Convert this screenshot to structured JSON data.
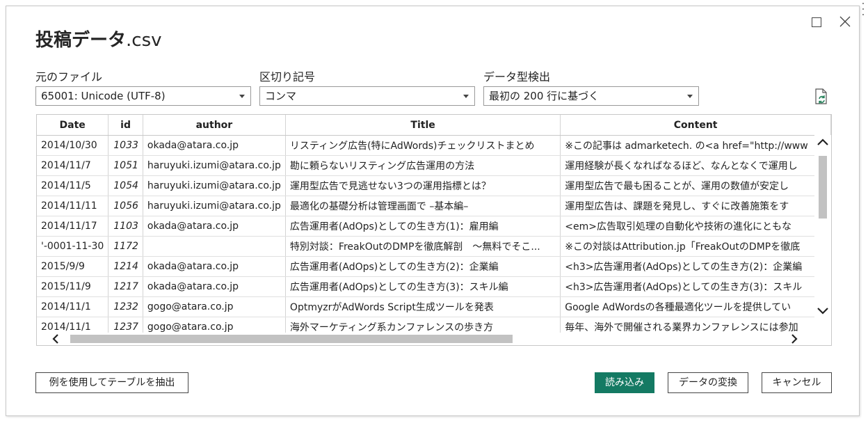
{
  "dialog": {
    "title_main": "投稿データ",
    "title_ext": ".csv"
  },
  "file_origin": {
    "label": "元のファイル",
    "value": "65001: Unicode (UTF-8)"
  },
  "delimiter": {
    "label": "区切り記号",
    "value": "コンマ"
  },
  "type_detection": {
    "label": "データ型検出",
    "value": "最初の 200 行に基づく"
  },
  "table": {
    "columns": [
      "Date",
      "id",
      "author",
      "Title",
      "Content"
    ],
    "rows": [
      [
        "2014/10/30",
        "1033",
        "okada@atara.co.jp",
        "リスティング広告(特にAdWords)チェックリストまとめ",
        "※この記事は admarketech. の<a href=\"http://www"
      ],
      [
        "2014/11/7",
        "1051",
        "haruyuki.izumi@atara.co.jp",
        "勘に頼らないリスティング広告運用の方法",
        "運用経験が長くなればなるほど、なんとなくで運用し"
      ],
      [
        "2014/11/5",
        "1054",
        "haruyuki.izumi@atara.co.jp",
        "運用型広告で見逃せない3つの運用指標とは？",
        "運用型広告で最も困ることが、運用の数値が安定し"
      ],
      [
        "2014/11/11",
        "1056",
        "haruyuki.izumi@atara.co.jp",
        "最適化の基礎分析は管理画面で –基本編–",
        "運用型広告は、課題を発見し、すぐに改善施策をす"
      ],
      [
        "2014/11/17",
        "1103",
        "okada@atara.co.jp",
        "広告運用者(AdOps)としての生き方(1)：雇用編",
        "<em>広告取引処理の自動化や技術の進化にともな"
      ],
      [
        "'-0001-11-30",
        "1172",
        "",
        "特別対談：FreakOutのDMPを徹底解剖　～無料でそこ...",
        "※この対談はAttribution.jp「FreakOutのDMPを徹底"
      ],
      [
        "2015/9/9",
        "1214",
        "okada@atara.co.jp",
        "広告運用者(AdOps)としての生き方(2)：企業編",
        "<h3>広告運用者(AdOps)としての生き方(2)：企業編"
      ],
      [
        "2015/11/9",
        "1217",
        "okada@atara.co.jp",
        "広告運用者(AdOps)としての生き方(3)：スキル編",
        "<h3>広告運用者(AdOps)としての生き方(3)：スキル"
      ],
      [
        "2014/11/1",
        "1232",
        "gogo@atara.co.jp",
        "OptmyzrがAdWords Script生成ツールを発表",
        "Google AdWordsの各種最適化ツールを提供してい"
      ],
      [
        "2014/11/1",
        "1237",
        "gogo@atara.co.jp",
        "海外マーケティング系カンファレンスの歩き方",
        "毎年、海外で開催される業界カンファレンスには参加"
      ]
    ]
  },
  "buttons": {
    "extract": "例を使用してテーブルを抽出",
    "load": "読み込み",
    "transform": "データの変換",
    "cancel": "キャンセル"
  }
}
